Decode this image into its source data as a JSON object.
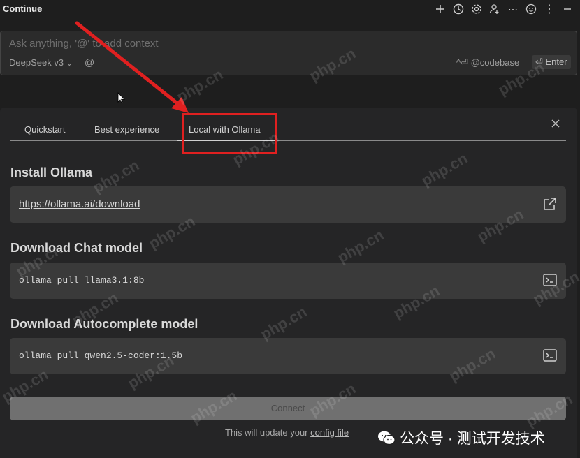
{
  "header": {
    "title": "Continue",
    "icons": [
      "plus-icon",
      "history-icon",
      "gear-icon",
      "add-user-icon",
      "more-icon",
      "emoji-icon",
      "kebab-icon",
      "minimize-icon"
    ]
  },
  "input": {
    "placeholder": "Ask anything, '@' to add context",
    "model": "DeepSeek v3",
    "chevron": "⌄",
    "at_symbol": "@",
    "hint": "^⏎ @codebase",
    "enter": "⏎ Enter"
  },
  "panel": {
    "tabs": [
      "Quickstart",
      "Best experience",
      "Local with Ollama"
    ],
    "active_tab": "Local with Ollama",
    "sections": [
      {
        "title": "Install Ollama",
        "value": "https://ollama.ai/download",
        "icon": "external-link-icon"
      },
      {
        "title": "Download Chat model",
        "value": "ollama pull llama3.1:8b",
        "icon": "terminal-icon"
      },
      {
        "title": "Download Autocomplete model",
        "value": "ollama pull qwen2.5-coder:1.5b",
        "icon": "terminal-icon"
      }
    ],
    "connect_label": "Connect",
    "footer_prefix": "This will update your ",
    "footer_link": "config file"
  },
  "watermark": {
    "text": "php.cn",
    "brand": "公众号 · 测试开发技术"
  },
  "colors": {
    "annotation": "#e02020",
    "panel": "#252526",
    "card": "#3a3a3a"
  }
}
